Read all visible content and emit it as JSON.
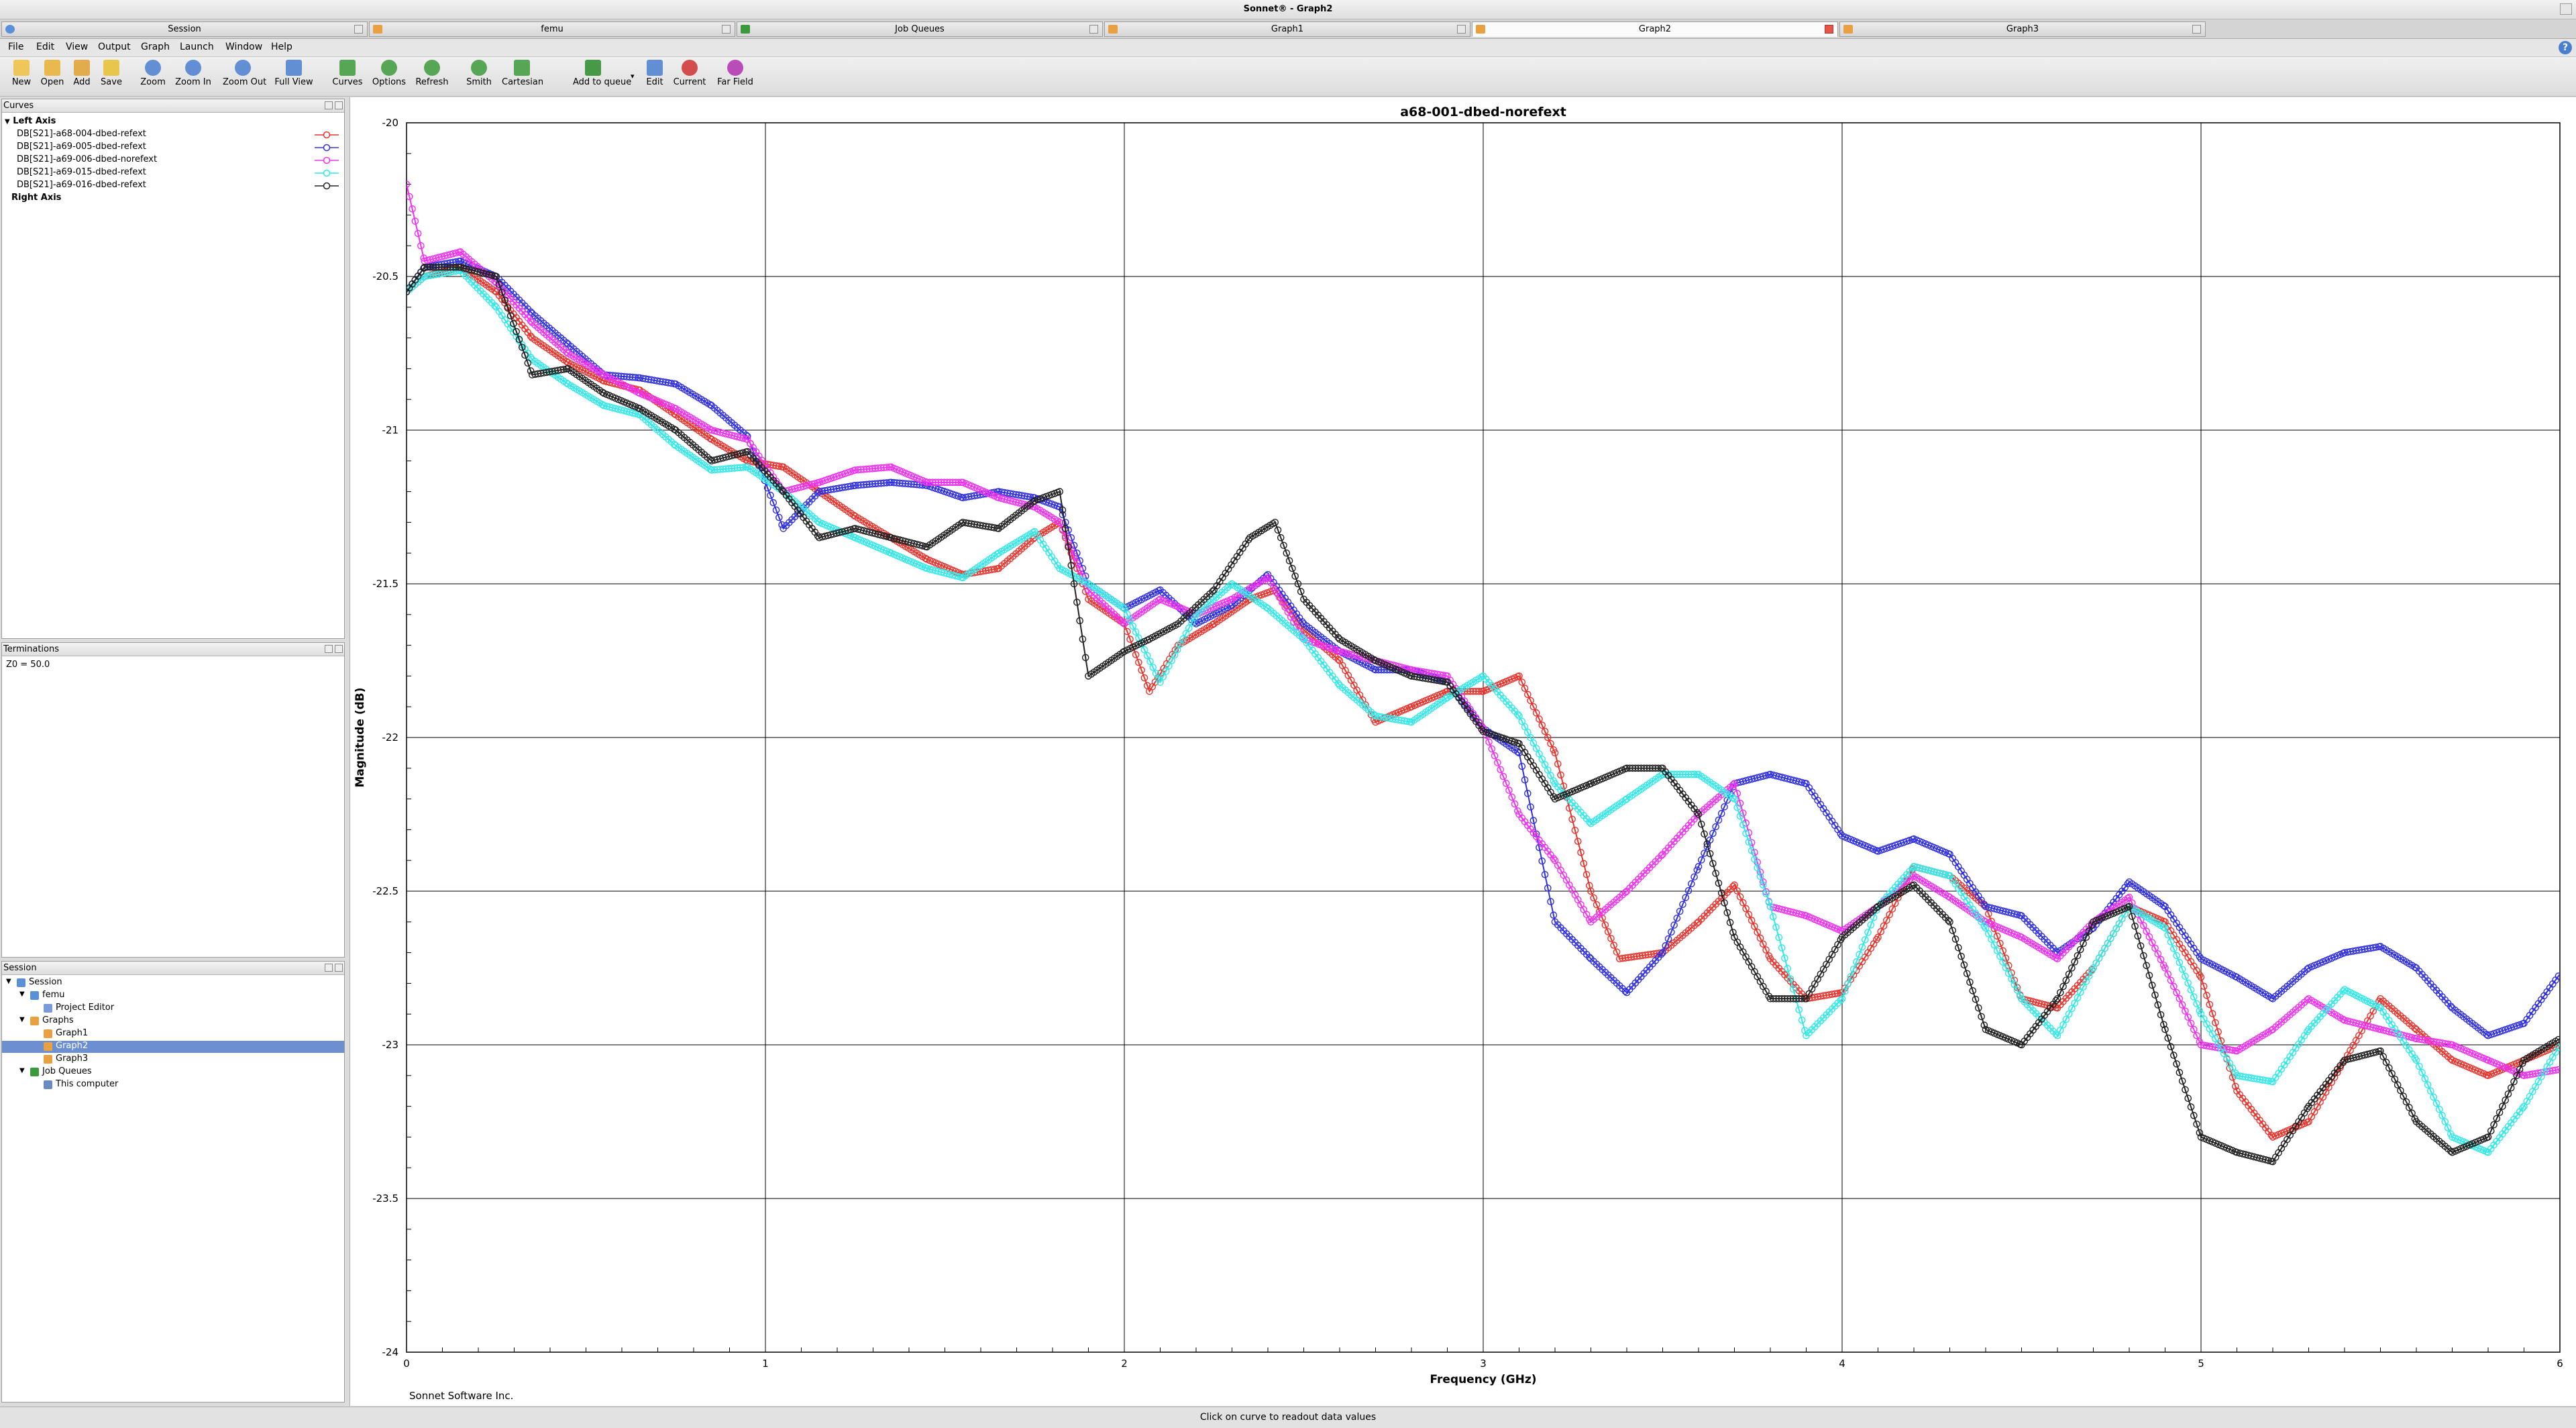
{
  "window": {
    "title": "Sonnet® - Graph2"
  },
  "tabs": [
    {
      "label": "Session",
      "icon": "session-icon",
      "active": false
    },
    {
      "label": "femu",
      "icon": "project-icon",
      "active": false
    },
    {
      "label": "Job Queues",
      "icon": "queue-icon",
      "active": false
    },
    {
      "label": "Graph1",
      "icon": "graph-icon",
      "active": false
    },
    {
      "label": "Graph2",
      "icon": "graph-icon",
      "active": true
    },
    {
      "label": "Graph3",
      "icon": "graph-icon",
      "active": false
    }
  ],
  "menu": [
    "File",
    "Edit",
    "View",
    "Output",
    "Graph",
    "Launch",
    "Window",
    "Help"
  ],
  "toolbar": [
    {
      "label": "New",
      "icon": "new-icon"
    },
    {
      "label": "Open",
      "icon": "open-folder-icon"
    },
    {
      "label": "Add",
      "icon": "add-icon"
    },
    {
      "label": "Save",
      "icon": "save-icon"
    },
    {
      "label": "Zoom",
      "icon": "zoom-icon"
    },
    {
      "label": "Zoom In",
      "icon": "zoom-in-icon"
    },
    {
      "label": "Zoom Out",
      "icon": "zoom-out-icon"
    },
    {
      "label": "Full View",
      "icon": "full-view-icon"
    },
    {
      "label": "Curves",
      "icon": "curves-icon"
    },
    {
      "label": "Options",
      "icon": "options-icon"
    },
    {
      "label": "Refresh",
      "icon": "refresh-icon"
    },
    {
      "label": "Smith",
      "icon": "smith-chart-icon"
    },
    {
      "label": "Cartesian",
      "icon": "cartesian-icon"
    },
    {
      "label": "Add to queue",
      "icon": "add-to-queue-icon"
    },
    {
      "label": "Edit",
      "icon": "edit-icon"
    },
    {
      "label": "Current",
      "icon": "current-icon"
    },
    {
      "label": "Far Field",
      "icon": "far-field-icon"
    }
  ],
  "curves_panel": {
    "title": "Curves",
    "left_axis_label": "Left Axis",
    "right_axis_label": "Right Axis",
    "items": [
      {
        "label": "DB[S21]-a68-004-dbed-refext",
        "color": "#e8332d"
      },
      {
        "label": "DB[S21]-a69-005-dbed-refext",
        "color": "#3030e0"
      },
      {
        "label": "DB[S21]-a69-006-dbed-norefext",
        "color": "#f030f0"
      },
      {
        "label": "DB[S21]-a69-015-dbed-refext",
        "color": "#30e8e8"
      },
      {
        "label": "DB[S21]-a69-016-dbed-refext",
        "color": "#222222"
      }
    ]
  },
  "terminations_panel": {
    "title": "Terminations",
    "text": "Z0 = 50.0"
  },
  "session_panel": {
    "title": "Session",
    "tree": [
      {
        "label": "Session",
        "level": 0,
        "expander": true,
        "icon": "session-icon"
      },
      {
        "label": "femu",
        "level": 1,
        "expander": true,
        "icon": "project-icon"
      },
      {
        "label": "Project Editor",
        "level": 2,
        "expander": false,
        "icon": "editor-icon"
      },
      {
        "label": "Graphs",
        "level": 1,
        "expander": true,
        "icon": "graphs-folder-icon"
      },
      {
        "label": "Graph1",
        "level": 2,
        "expander": false,
        "icon": "graph-icon"
      },
      {
        "label": "Graph2",
        "level": 2,
        "expander": false,
        "icon": "graph-icon",
        "selected": true
      },
      {
        "label": "Graph3",
        "level": 2,
        "expander": false,
        "icon": "graph-icon"
      },
      {
        "label": "Job Queues",
        "level": 1,
        "expander": true,
        "icon": "queue-icon"
      },
      {
        "label": "This computer",
        "level": 2,
        "expander": false,
        "icon": "computer-icon"
      }
    ]
  },
  "graph": {
    "credit": "Sonnet Software Inc."
  },
  "status": {
    "text": "Click on curve to readout data values"
  },
  "chart_data": {
    "type": "line",
    "title": "a68-001-dbed-norefext",
    "xlabel": "Frequency (GHz)",
    "ylabel": "Magnitude (dB)",
    "xlim": [
      0,
      6
    ],
    "ylim": [
      -24,
      -20
    ],
    "xticks": [
      0,
      1,
      2,
      3,
      4,
      5,
      6
    ],
    "yticks": [
      -20,
      -20.5,
      -21,
      -21.5,
      -22,
      -22.5,
      -23,
      -23.5,
      -24
    ],
    "grid": true,
    "marker": "circle",
    "series": [
      {
        "name": "DB[S21]-a68-004-dbed-refext",
        "color": "#e8332d",
        "x": [
          0,
          0.05,
          0.15,
          0.25,
          0.35,
          0.45,
          0.55,
          0.65,
          0.75,
          0.85,
          0.95,
          1.05,
          1.15,
          1.25,
          1.35,
          1.45,
          1.55,
          1.65,
          1.75,
          1.82,
          1.9,
          2.0,
          2.07,
          2.15,
          2.25,
          2.35,
          2.42,
          2.5,
          2.6,
          2.7,
          2.8,
          2.9,
          3.0,
          3.1,
          3.2,
          3.3,
          3.38,
          3.5,
          3.6,
          3.7,
          3.8,
          3.9,
          4.0,
          4.1,
          4.2,
          4.3,
          4.4,
          4.5,
          4.6,
          4.7,
          4.8,
          4.9,
          5.0,
          5.1,
          5.2,
          5.3,
          5.4,
          5.5,
          5.6,
          5.7,
          5.8,
          5.9,
          6.0
        ],
        "y": [
          -20.55,
          -20.5,
          -20.47,
          -20.55,
          -20.7,
          -20.78,
          -20.84,
          -20.87,
          -20.95,
          -21.03,
          -21.1,
          -21.12,
          -21.2,
          -21.28,
          -21.35,
          -21.42,
          -21.47,
          -21.45,
          -21.35,
          -21.3,
          -21.55,
          -21.63,
          -21.85,
          -21.7,
          -21.63,
          -21.55,
          -21.52,
          -21.65,
          -21.75,
          -21.95,
          -21.9,
          -21.85,
          -21.85,
          -21.8,
          -22.05,
          -22.5,
          -22.72,
          -22.7,
          -22.6,
          -22.48,
          -22.72,
          -22.85,
          -22.83,
          -22.65,
          -22.42,
          -22.45,
          -22.55,
          -22.85,
          -22.88,
          -22.75,
          -22.55,
          -22.6,
          -22.78,
          -23.15,
          -23.3,
          -23.25,
          -23.05,
          -22.85,
          -22.95,
          -23.05,
          -23.1,
          -23.05,
          -23.0
        ]
      },
      {
        "name": "DB[S21]-a69-005-dbed-refext",
        "color": "#3030e0",
        "x": [
          0,
          0.05,
          0.15,
          0.25,
          0.35,
          0.45,
          0.55,
          0.65,
          0.75,
          0.85,
          0.95,
          1.05,
          1.15,
          1.25,
          1.35,
          1.45,
          1.55,
          1.65,
          1.75,
          1.82,
          1.9,
          2.0,
          2.1,
          2.2,
          2.3,
          2.4,
          2.5,
          2.6,
          2.7,
          2.8,
          2.9,
          3.0,
          3.1,
          3.2,
          3.3,
          3.4,
          3.5,
          3.6,
          3.7,
          3.8,
          3.9,
          4.0,
          4.1,
          4.2,
          4.3,
          4.4,
          4.5,
          4.6,
          4.7,
          4.8,
          4.9,
          5.0,
          5.1,
          5.2,
          5.3,
          5.4,
          5.5,
          5.6,
          5.7,
          5.8,
          5.9,
          6.0
        ],
        "y": [
          -20.55,
          -20.47,
          -20.45,
          -20.5,
          -20.62,
          -20.72,
          -20.82,
          -20.83,
          -20.85,
          -20.92,
          -21.02,
          -21.32,
          -21.2,
          -21.18,
          -21.17,
          -21.18,
          -21.22,
          -21.2,
          -21.22,
          -21.25,
          -21.5,
          -21.58,
          -21.52,
          -21.63,
          -21.57,
          -21.47,
          -21.63,
          -21.72,
          -21.78,
          -21.78,
          -21.82,
          -21.97,
          -22.05,
          -22.6,
          -22.72,
          -22.83,
          -22.7,
          -22.42,
          -22.15,
          -22.12,
          -22.15,
          -22.32,
          -22.37,
          -22.33,
          -22.38,
          -22.55,
          -22.58,
          -22.7,
          -22.62,
          -22.47,
          -22.55,
          -22.72,
          -22.78,
          -22.85,
          -22.75,
          -22.7,
          -22.68,
          -22.75,
          -22.88,
          -22.97,
          -22.93,
          -22.77
        ]
      },
      {
        "name": "DB[S21]-a69-006-dbed-norefext",
        "color": "#f030f0",
        "x": [
          0,
          0.05,
          0.15,
          0.25,
          0.35,
          0.45,
          0.55,
          0.65,
          0.75,
          0.85,
          0.95,
          1.05,
          1.15,
          1.25,
          1.35,
          1.45,
          1.55,
          1.65,
          1.75,
          1.82,
          1.9,
          2.0,
          2.1,
          2.2,
          2.3,
          2.4,
          2.5,
          2.6,
          2.7,
          2.8,
          2.9,
          3.0,
          3.1,
          3.2,
          3.3,
          3.4,
          3.5,
          3.6,
          3.7,
          3.8,
          3.9,
          4.0,
          4.1,
          4.2,
          4.3,
          4.4,
          4.5,
          4.6,
          4.7,
          4.8,
          4.9,
          5.0,
          5.1,
          5.2,
          5.3,
          5.4,
          5.5,
          5.6,
          5.7,
          5.8,
          5.9,
          6.0
        ],
        "y": [
          -20.2,
          -20.45,
          -20.42,
          -20.52,
          -20.65,
          -20.75,
          -20.82,
          -20.88,
          -20.93,
          -21.0,
          -21.03,
          -21.2,
          -21.17,
          -21.13,
          -21.12,
          -21.17,
          -21.17,
          -21.22,
          -21.25,
          -21.3,
          -21.52,
          -21.63,
          -21.55,
          -21.6,
          -21.55,
          -21.48,
          -21.68,
          -21.72,
          -21.75,
          -21.78,
          -21.8,
          -21.97,
          -22.25,
          -22.4,
          -22.6,
          -22.5,
          -22.38,
          -22.25,
          -22.15,
          -22.55,
          -22.58,
          -22.63,
          -22.55,
          -22.45,
          -22.52,
          -22.6,
          -22.65,
          -22.72,
          -22.6,
          -22.52,
          -22.75,
          -23.0,
          -23.02,
          -22.95,
          -22.85,
          -22.92,
          -22.95,
          -22.98,
          -23.0,
          -23.05,
          -23.1,
          -23.08
        ]
      },
      {
        "name": "DB[S21]-a69-015-dbed-refext",
        "color": "#30e8e8",
        "x": [
          0,
          0.05,
          0.15,
          0.25,
          0.35,
          0.45,
          0.55,
          0.65,
          0.75,
          0.85,
          0.95,
          1.05,
          1.15,
          1.25,
          1.35,
          1.45,
          1.55,
          1.65,
          1.75,
          1.82,
          1.9,
          2.0,
          2.1,
          2.2,
          2.3,
          2.4,
          2.5,
          2.6,
          2.7,
          2.8,
          2.9,
          3.0,
          3.1,
          3.2,
          3.3,
          3.4,
          3.5,
          3.6,
          3.7,
          3.8,
          3.9,
          4.0,
          4.1,
          4.2,
          4.3,
          4.4,
          4.5,
          4.6,
          4.7,
          4.8,
          4.9,
          5.0,
          5.1,
          5.2,
          5.3,
          5.4,
          5.5,
          5.6,
          5.7,
          5.8,
          5.9,
          6.0
        ],
        "y": [
          -20.55,
          -20.5,
          -20.48,
          -20.6,
          -20.77,
          -20.85,
          -20.92,
          -20.95,
          -21.05,
          -21.13,
          -21.12,
          -21.2,
          -21.3,
          -21.35,
          -21.4,
          -21.45,
          -21.48,
          -21.4,
          -21.33,
          -21.45,
          -21.5,
          -21.58,
          -21.82,
          -21.6,
          -21.5,
          -21.58,
          -21.68,
          -21.83,
          -21.93,
          -21.95,
          -21.87,
          -21.8,
          -21.93,
          -22.15,
          -22.28,
          -22.2,
          -22.12,
          -22.12,
          -22.2,
          -22.55,
          -22.97,
          -22.85,
          -22.55,
          -22.42,
          -22.45,
          -22.62,
          -22.85,
          -22.97,
          -22.75,
          -22.55,
          -22.62,
          -22.9,
          -23.1,
          -23.12,
          -22.95,
          -22.82,
          -22.88,
          -23.05,
          -23.3,
          -23.35,
          -23.2,
          -23.0
        ]
      },
      {
        "name": "DB[S21]-a69-016-dbed-refext",
        "color": "#222222",
        "x": [
          0,
          0.05,
          0.15,
          0.25,
          0.35,
          0.45,
          0.55,
          0.65,
          0.75,
          0.85,
          0.95,
          1.05,
          1.15,
          1.25,
          1.35,
          1.45,
          1.55,
          1.65,
          1.75,
          1.82,
          1.9,
          2.0,
          2.07,
          2.15,
          2.25,
          2.35,
          2.42,
          2.5,
          2.6,
          2.7,
          2.8,
          2.9,
          3.0,
          3.1,
          3.2,
          3.3,
          3.4,
          3.5,
          3.6,
          3.7,
          3.8,
          3.9,
          4.0,
          4.1,
          4.2,
          4.3,
          4.4,
          4.5,
          4.6,
          4.7,
          4.8,
          4.9,
          5.0,
          5.1,
          5.2,
          5.3,
          5.4,
          5.5,
          5.6,
          5.7,
          5.8,
          5.9,
          6.0
        ],
        "y": [
          -20.55,
          -20.47,
          -20.47,
          -20.5,
          -20.82,
          -20.8,
          -20.88,
          -20.93,
          -21.0,
          -21.1,
          -21.07,
          -21.2,
          -21.35,
          -21.32,
          -21.35,
          -21.38,
          -21.3,
          -21.32,
          -21.23,
          -21.2,
          -21.8,
          -21.72,
          -21.68,
          -21.63,
          -21.52,
          -21.35,
          -21.3,
          -21.55,
          -21.68,
          -21.75,
          -21.8,
          -21.82,
          -21.98,
          -22.02,
          -22.2,
          -22.15,
          -22.1,
          -22.1,
          -22.25,
          -22.65,
          -22.85,
          -22.85,
          -22.65,
          -22.55,
          -22.48,
          -22.6,
          -22.95,
          -23.0,
          -22.85,
          -22.6,
          -22.55,
          -22.95,
          -23.3,
          -23.35,
          -23.38,
          -23.2,
          -23.05,
          -23.02,
          -23.25,
          -23.35,
          -23.3,
          -23.05,
          -22.98
        ]
      }
    ]
  }
}
